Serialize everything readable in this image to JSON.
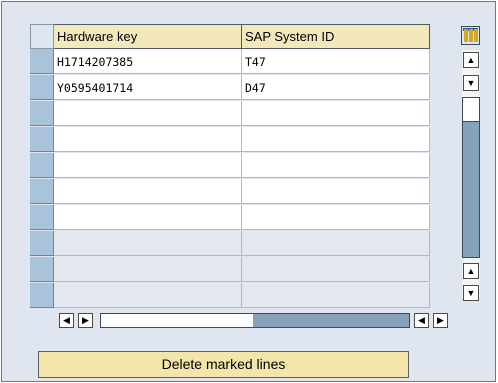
{
  "table": {
    "columns": [
      "Hardware key",
      "SAP System ID"
    ],
    "rows": [
      [
        "H1714207385",
        "T47"
      ],
      [
        "Y0595401714",
        "D47"
      ],
      [
        "",
        ""
      ],
      [
        "",
        ""
      ],
      [
        "",
        ""
      ],
      [
        "",
        ""
      ],
      [
        "",
        ""
      ],
      [
        "",
        ""
      ],
      [
        "",
        ""
      ],
      [
        "",
        ""
      ]
    ]
  },
  "actions": {
    "delete_label": "Delete marked lines"
  },
  "icons": {
    "column_settings": "column-layout-icon",
    "scroll_up": "arrow-up-icon",
    "scroll_down": "arrow-down-icon",
    "scroll_left": "arrow-left-icon",
    "scroll_right": "arrow-right-icon"
  },
  "colors": {
    "header_bg": "#f2e8bb",
    "button_bg": "#f4e5a8",
    "row_selector": "#a9c3da",
    "panel_bg": "#dfe6ef"
  }
}
